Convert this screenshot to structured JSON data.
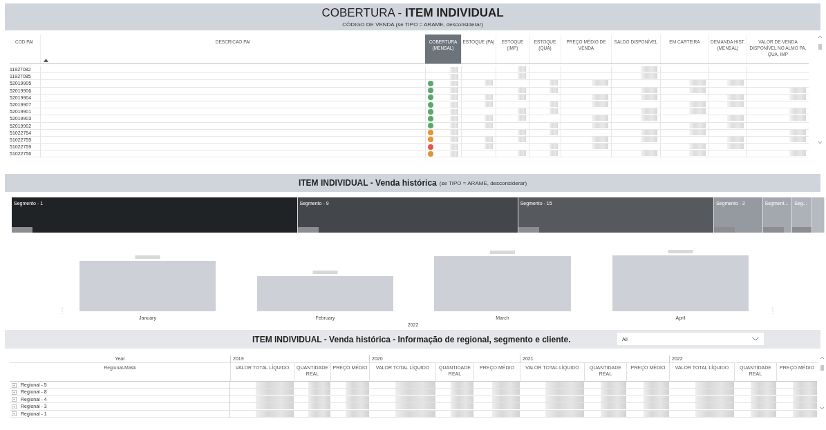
{
  "coverage_panel": {
    "title": "COBERTURA - **ITEM INDIVIDUAL**",
    "subtitle": "CÓDIGO DE VENDA (se TIPO = ARAME, desconsiderar)",
    "columns": [
      {
        "label": "COD PAI",
        "selected": false,
        "sorted": false
      },
      {
        "label": "DESCRICAO PAI",
        "selected": false,
        "sorted": true
      },
      {
        "label": "COBERTURA (MENSAL)",
        "selected": true,
        "sorted": false
      },
      {
        "label": "ESTOQUE (PA)",
        "selected": false,
        "sorted": false
      },
      {
        "label": "ESTOQUE (IMP)",
        "selected": false,
        "sorted": false
      },
      {
        "label": "ESTOQUE (QUA)",
        "selected": false,
        "sorted": false
      },
      {
        "label": "PREÇO MÉDIO DE VENDA",
        "selected": false,
        "sorted": false
      },
      {
        "label": "SALDO DISPONÍVEL",
        "selected": false,
        "sorted": false
      },
      {
        "label": "EM CARTEIRA",
        "selected": false,
        "sorted": false
      },
      {
        "label": "DEMANDA HIST. (MENSAL)",
        "selected": false,
        "sorted": false
      },
      {
        "label": "VALOR DE VENDA DISPONÍVEL NO ALMO PA, QUA, IMP",
        "selected": false,
        "sorted": false
      }
    ],
    "rows": [
      {
        "code": "11927082"
      },
      {
        "code": "11927085"
      },
      {
        "code": "52019905",
        "color": "#5aa86a"
      },
      {
        "code": "52019906",
        "color": "#5aa86a"
      },
      {
        "code": "52019904",
        "color": "#5aa86a"
      },
      {
        "code": "52019907",
        "color": "#5aa86a"
      },
      {
        "code": "52019901",
        "color": "#5aa86a"
      },
      {
        "code": "52019903",
        "color": "#5aa86a"
      },
      {
        "code": "52019902",
        "color": "#5aa86a"
      },
      {
        "code": "51022754",
        "color": "#e0972e"
      },
      {
        "code": "51022755",
        "color": "#e0972e"
      },
      {
        "code": "51022759",
        "color": "#e8534f"
      },
      {
        "code": "51022756",
        "color": "#e0972e"
      }
    ]
  },
  "history_panel": {
    "title": "ITEM INDIVIDUAL - Venda histórica",
    "note": "(se TIPO = ARAME, desconsiderar)",
    "segments": [
      {
        "label": "Segmento - 1",
        "color": "#202326"
      },
      {
        "label": "Segmento - 9",
        "color": "#43474b"
      },
      {
        "label": "Segmento - 15",
        "color": "#56595d"
      },
      {
        "label": "Segmento - 2",
        "color": "#959aa0"
      },
      {
        "label": "Segment...",
        "color": "#a3a8ae"
      },
      {
        "label": "Seg...",
        "color": "#adb2b8"
      }
    ],
    "months": [
      "January",
      "February",
      "March",
      "April"
    ],
    "year": "2022"
  },
  "regional_panel": {
    "title": "ITEM INDIVIDUAL - Venda histórica - Informação de regional, segmento e cliente.",
    "filter": {
      "value": "All"
    },
    "row_header": {
      "year_label": "Year",
      "row_label": "Regional-Mask"
    },
    "years": [
      {
        "year": "2019",
        "measures": [
          "VALOR TOTAL LÍQUIDO",
          "QUANTIDADE REAL",
          "PREÇO MÉDIO"
        ]
      },
      {
        "year": "2020",
        "measures": [
          "VALOR TOTAL LÍQUIDO",
          "QUANTIDADE REAL",
          "PREÇO MÉDIO"
        ]
      },
      {
        "year": "2021",
        "measures": [
          "VALOR TOTAL LÍQUIDO",
          "QUANTIDADE REAL",
          "PREÇO MÉDIO"
        ]
      },
      {
        "year": "2022",
        "measures": [
          "VALOR TOTAL LÍQUIDO",
          "QUANTIDADE REAL",
          "PREÇO MÉDIO"
        ]
      }
    ],
    "rows": [
      {
        "label": "Regional - 5",
        "expanded": false
      },
      {
        "label": "Regional - 8",
        "expanded": false
      },
      {
        "label": "Regional - 4",
        "expanded": false
      },
      {
        "label": "Regional - 3",
        "expanded": false
      },
      {
        "label": "Regional - 1",
        "expanded": false
      }
    ]
  }
}
